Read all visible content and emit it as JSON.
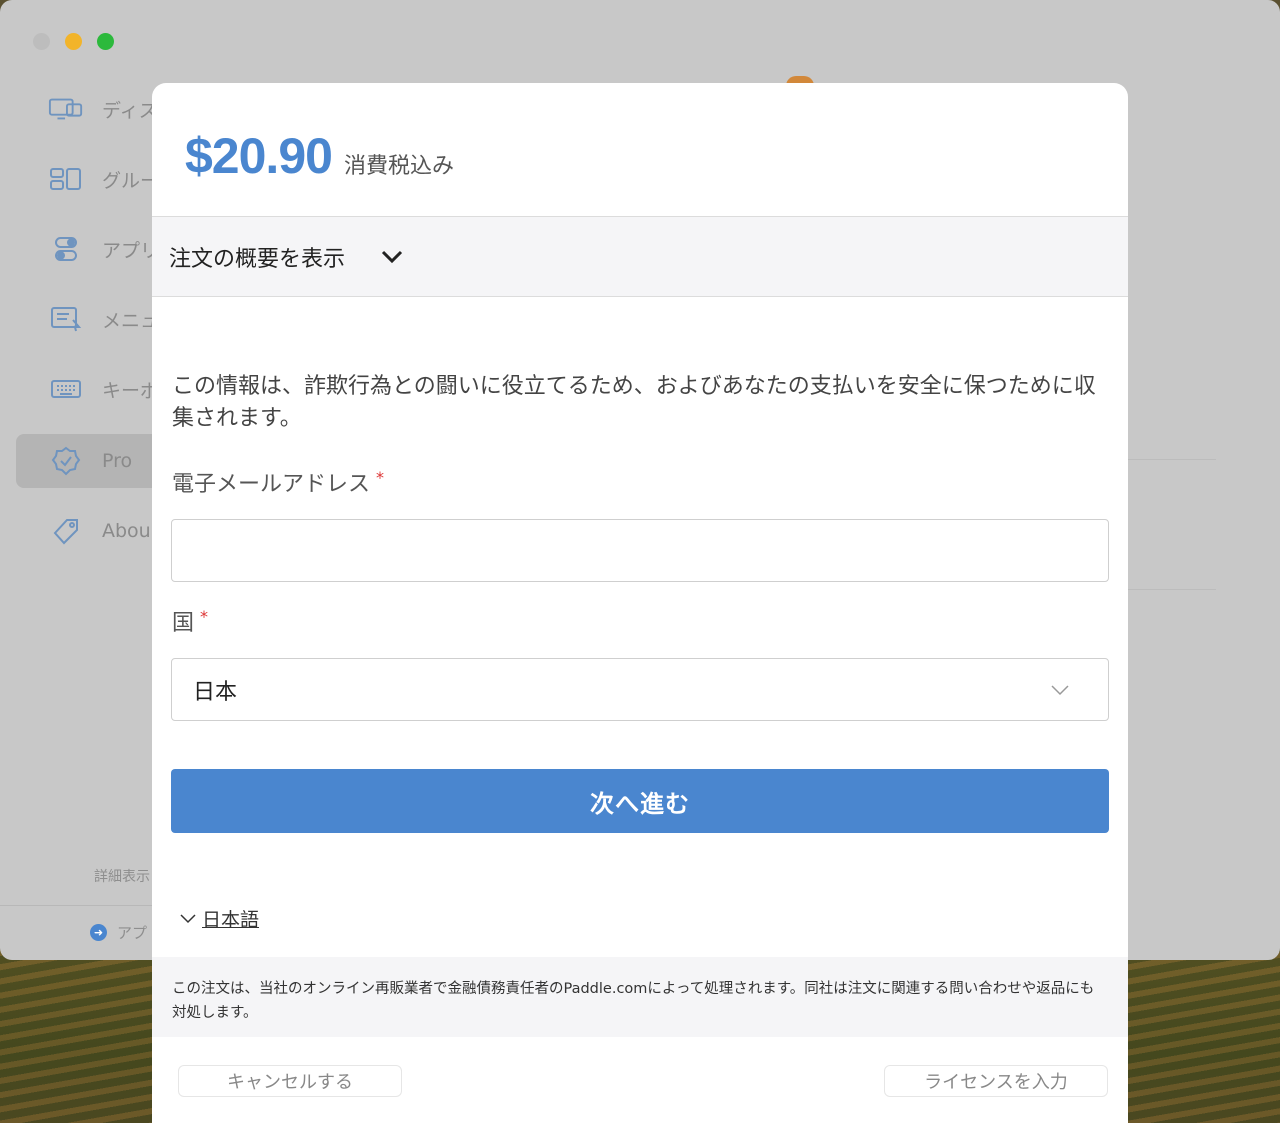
{
  "background_app": {
    "sidebar": {
      "items": [
        {
          "label": "ディス",
          "icon": "display-icon"
        },
        {
          "label": "グルー",
          "icon": "group-icon"
        },
        {
          "label": "アプリ",
          "icon": "toggle-icon"
        },
        {
          "label": "メニュ",
          "icon": "menu-icon"
        },
        {
          "label": "キーボ",
          "icon": "keyboard-icon"
        },
        {
          "label": "Pro",
          "icon": "badge-check-icon",
          "active": true
        },
        {
          "label": "Abou",
          "icon": "tag-icon"
        }
      ],
      "footer_label": "詳細表示",
      "update_label": "アプ"
    }
  },
  "modal": {
    "price": "$20.90",
    "tax_note": "消費税込み",
    "summary_toggle": "注文の概要を表示",
    "info_text": "この情報は、詐欺行為との闘いに役立てるため、およびあなたの支払いを安全に保つために収集されます。",
    "email": {
      "label": "電子メールアドレス",
      "required_mark": "*",
      "value": "",
      "placeholder": ""
    },
    "country": {
      "label": "国",
      "required_mark": "*",
      "value": "日本"
    },
    "next_button": "次へ進む",
    "language": "日本語",
    "notice": "この注文は、当社のオンライン再販業者で金融債務責任者のPaddle.comによって処理されます。同社は注文に関連する問い合わせや返品にも対処します。",
    "cancel_button": "キャンセルする",
    "license_button": "ライセンスを入力"
  },
  "colors": {
    "accent": "#4a86cf",
    "required": "#dd3333"
  }
}
